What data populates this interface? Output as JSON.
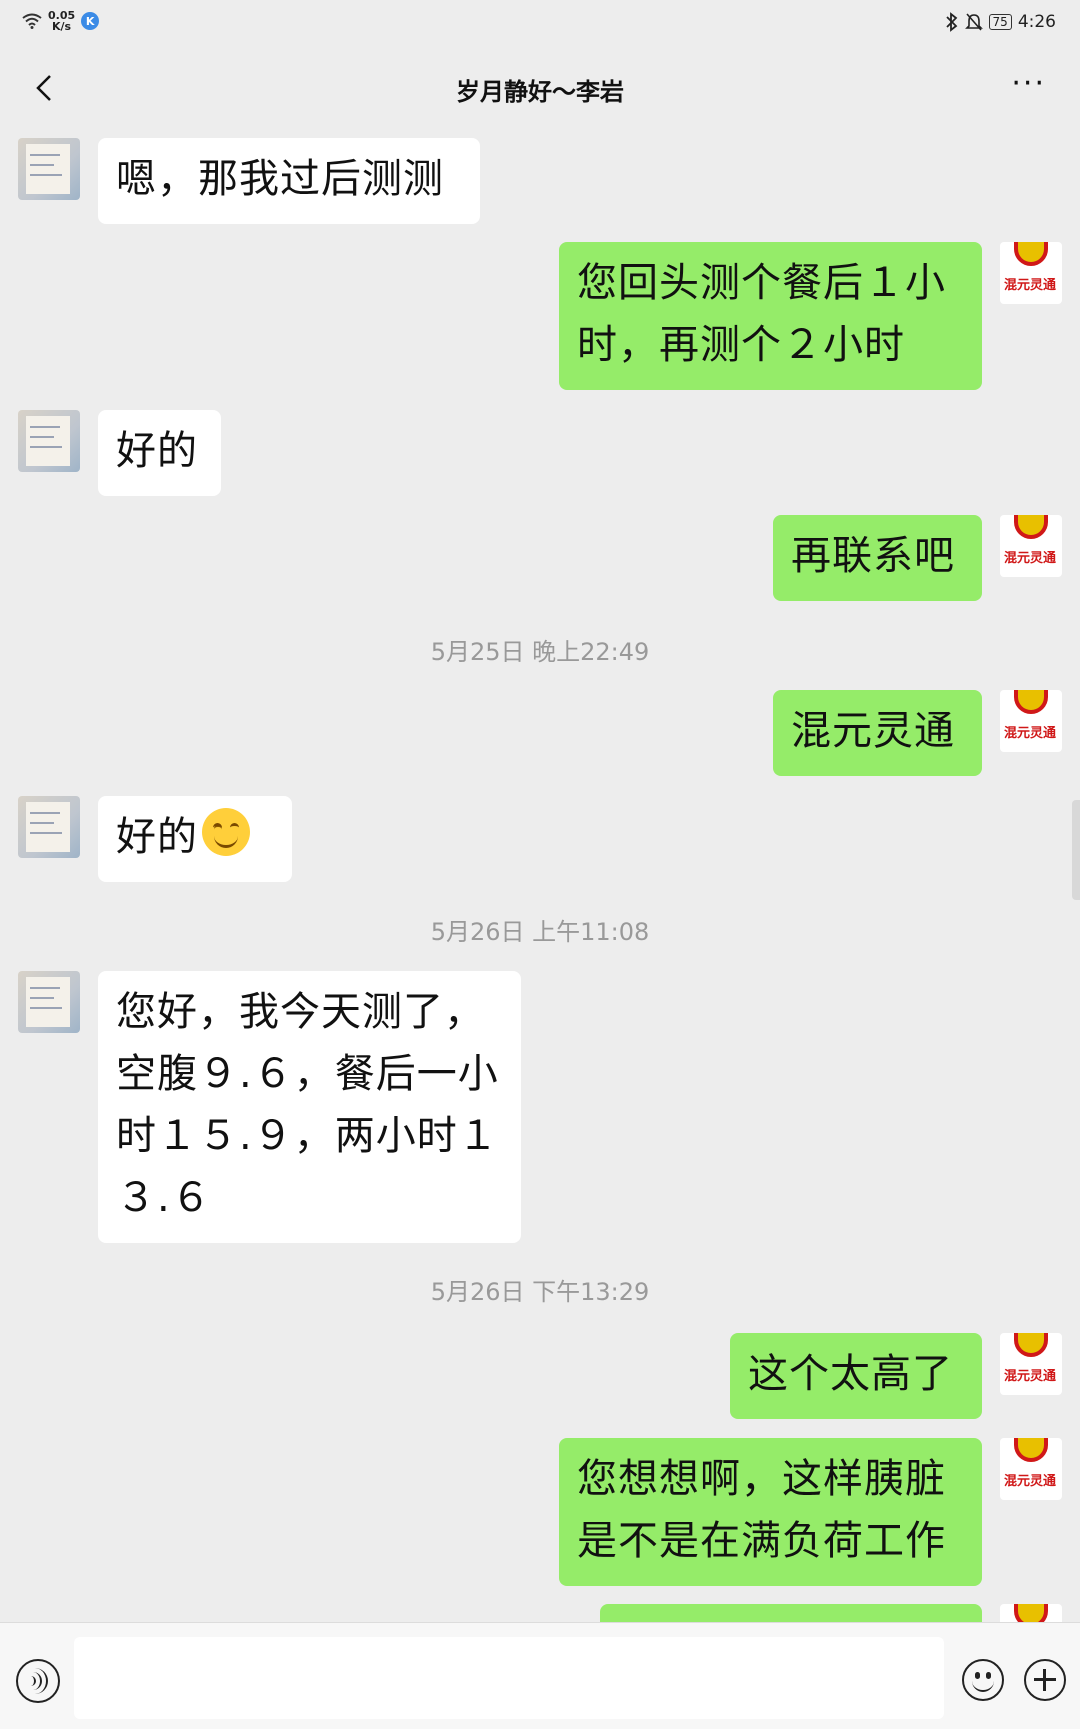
{
  "status_bar": {
    "net_speed_value": "0.05",
    "net_speed_unit": "K/s",
    "app_badge": "K",
    "battery": "75",
    "time": "4:26"
  },
  "header": {
    "title": "岁月静好～李岩",
    "more": "···"
  },
  "seal_text": "混元灵通",
  "messages": [
    {
      "side": "recv",
      "text": "嗯，那我过后测测"
    },
    {
      "side": "sent",
      "text": "您回头测个餐后１小时，再测个２小时"
    },
    {
      "side": "recv",
      "text": "好的"
    },
    {
      "side": "sent",
      "text": "再联系吧"
    },
    {
      "side": "time",
      "text": "5月25日 晚上22:49"
    },
    {
      "side": "sent",
      "text": "混元灵通"
    },
    {
      "side": "recv",
      "text": "好的",
      "emoji": "smiling-face"
    },
    {
      "side": "time",
      "text": "5月26日 上午11:08"
    },
    {
      "side": "recv",
      "text": "您好，我今天测了，空腹９.６，餐后一小时１５.９，两小时１３.６"
    },
    {
      "side": "time",
      "text": "5月26日 下午13:29"
    },
    {
      "side": "sent",
      "text": "这个太高了"
    },
    {
      "side": "sent",
      "text": "您想想啊，这样胰脏是不是在满负荷工作"
    }
  ],
  "input": {
    "placeholder": ""
  }
}
